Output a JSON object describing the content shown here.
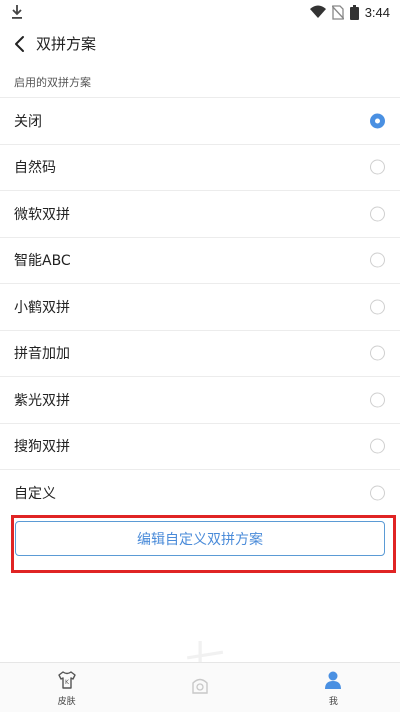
{
  "status_bar": {
    "time": "3:44",
    "icons": [
      "download-icon",
      "wifi-icon",
      "no-sim-icon",
      "battery-icon"
    ]
  },
  "header": {
    "back_icon": "chevron-left-icon",
    "title": "双拼方案"
  },
  "section": {
    "title": "启用的双拼方案"
  },
  "options": [
    {
      "label": "关闭",
      "selected": true
    },
    {
      "label": "自然码",
      "selected": false
    },
    {
      "label": "微软双拼",
      "selected": false
    },
    {
      "label": "智能ABC",
      "selected": false
    },
    {
      "label": "小鹤双拼",
      "selected": false
    },
    {
      "label": "拼音加加",
      "selected": false
    },
    {
      "label": "紫光双拼",
      "selected": false
    },
    {
      "label": "搜狗双拼",
      "selected": false
    },
    {
      "label": "自定义",
      "selected": false
    }
  ],
  "edit_button": {
    "label": "编辑自定义双拼方案"
  },
  "bottom_nav": {
    "items": [
      {
        "label": "皮肤",
        "icon": "shirt-icon"
      },
      {
        "label": "",
        "icon": "discover-icon"
      },
      {
        "label": "我",
        "icon": "user-icon"
      }
    ]
  },
  "colors": {
    "accent": "#4a90e2",
    "highlight": "#e02424",
    "divider": "#ececec"
  }
}
